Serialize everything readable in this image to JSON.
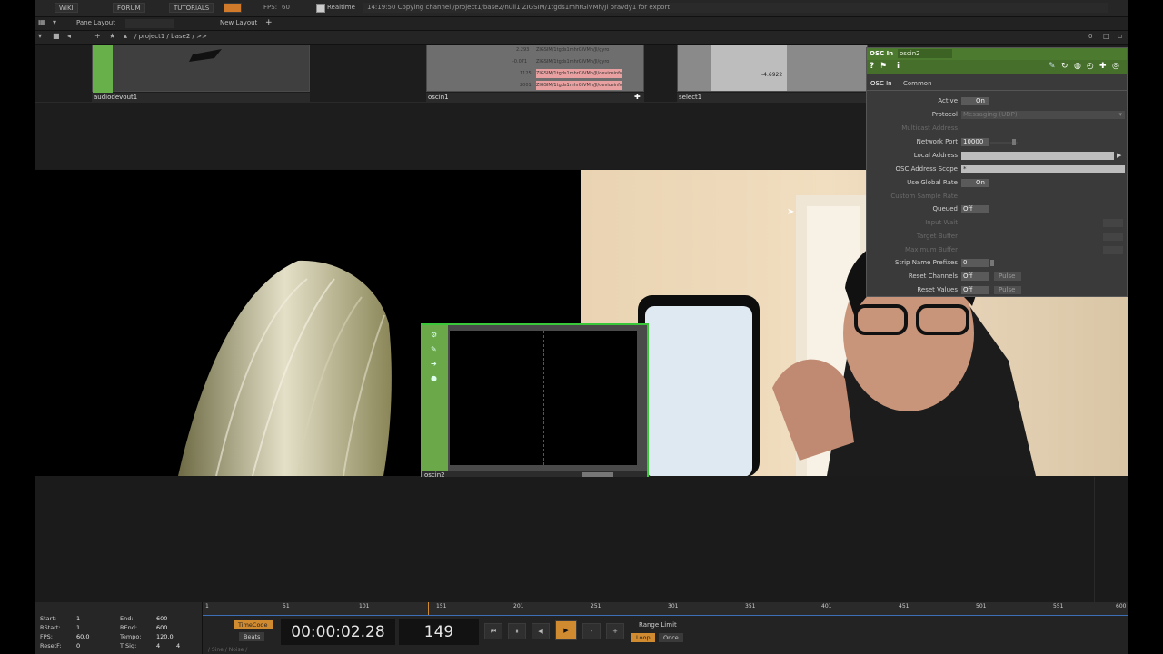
{
  "menubar": {
    "wiki": "WIKI",
    "forum": "FORUM",
    "tutorials": "TUTORIALS",
    "fps_label": "FPS:",
    "fps_value": "60",
    "realtime": "Realtime",
    "message": "14:19:50 Copying channel /project1/base2/null1 ZIGSIM/1tgds1mhrGiVMh/Jl pravdy1 for export"
  },
  "bar2": {
    "pane_layout": "Pane Layout",
    "new_layout": "New Layout",
    "plus": "+"
  },
  "bar3": {
    "path": "/ project1 / base2 / >>",
    "zero": "0"
  },
  "network": {
    "tile1_label": "audiodevout1",
    "tile2_label": "oscin1",
    "tile3_label": "select1",
    "tile3_value": "-4.6922",
    "oscin1_rows": [
      {
        "value": "2.293",
        "name": "ZIGSIM/1tgds1mhrGiVMh/Jl/gyro"
      },
      {
        "value": "-0.071",
        "name": "ZIGSIM/1tgds1mhrGiVMh/Jl/gyro"
      },
      {
        "value": "1125",
        "name": "ZIGSIM/1tgds1mhrGiVMh/Jl/deviceinfo"
      },
      {
        "value": "2001",
        "name": "ZIGSIM/1tgds1mhrGiVMh/Jl/deviceinfo"
      }
    ]
  },
  "oscin2_node": {
    "label": "oscin2"
  },
  "panel": {
    "op_type": "OSC In",
    "op_name": "oscin2",
    "tabs": [
      "OSC In",
      "Common"
    ],
    "params": [
      {
        "label": "Active",
        "value": "On",
        "dim": false
      },
      {
        "label": "Protocol",
        "value": "Messaging (UDP)",
        "dim": false
      },
      {
        "label": "Multicast Address",
        "value": "",
        "dim": true
      },
      {
        "label": "Network Port",
        "value": "10000",
        "dim": false
      },
      {
        "label": "Local Address",
        "value": "",
        "dim": false
      },
      {
        "label": "OSC Address Scope",
        "value": "*",
        "dim": false
      },
      {
        "label": "Use Global Rate",
        "value": "On",
        "dim": false
      },
      {
        "label": "Custom Sample Rate",
        "value": "",
        "dim": true
      },
      {
        "label": "Queued",
        "value": "Off",
        "dim": false
      },
      {
        "label": "Input Wait",
        "value": "",
        "dim": true
      },
      {
        "label": "Target Buffer",
        "value": "",
        "dim": true
      },
      {
        "label": "Maximum Buffer",
        "value": "",
        "dim": true
      },
      {
        "label": "Strip Name Prefixes",
        "value": "0",
        "dim": false
      },
      {
        "label": "Reset Channels",
        "value": "Off",
        "dim": false
      },
      {
        "label": "Reset Values",
        "value": "Off",
        "dim": false
      }
    ],
    "pulse_label": "Pulse"
  },
  "range": {
    "start_label": "Start:",
    "start_value": "1",
    "end_label": "End:",
    "end_value": "600",
    "rstart_label": "RStart:",
    "rstart_value": "1",
    "rend_label": "REnd:",
    "rend_value": "600",
    "fps_label": "FPS:",
    "fps_value": "60.0",
    "tempo_label": "Tempo:",
    "tempo_value": "120.0",
    "resetf_label": "ResetF:",
    "resetf_value": "0",
    "tsig_label": "T Sig:",
    "tsig_value": "4",
    "tsig_value2": "4"
  },
  "timeline": {
    "ticks": [
      "1",
      "51",
      "101",
      "151",
      "201",
      "251",
      "301",
      "351",
      "401",
      "451",
      "501",
      "551",
      "600"
    ]
  },
  "transport": {
    "timecode_label": "TimeCode",
    "beats_label": "Beats",
    "time": "00:00:02.28",
    "frame": "149",
    "range_limit": "Range Limit",
    "loop": "Loop",
    "once": "Once",
    "prev_icon": "⏮",
    "pause_icon": "⏸",
    "back_icon": "◀",
    "play_icon": "▶",
    "minus": "-",
    "plus": "+"
  },
  "footer": {
    "text": "/ Sine / Noise /"
  }
}
